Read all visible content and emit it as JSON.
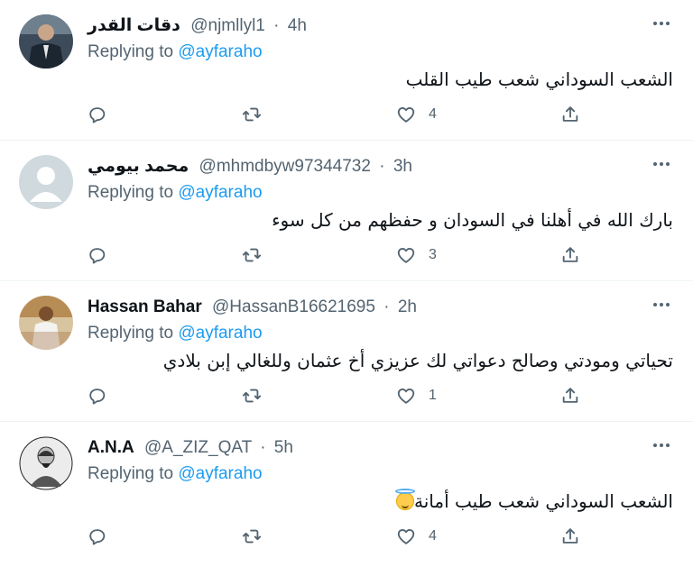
{
  "tweets": [
    {
      "name": "دقات القدر",
      "handle": "@njmllyl1",
      "dot": "·",
      "time": "4h",
      "replying_prefix": "Replying to ",
      "replying_to": "@ayfaraho",
      "text": "الشعب السوداني شعب طيب القلب",
      "has_emoji": false,
      "likes": "4",
      "avatar": "suit-photo"
    },
    {
      "name": "محمد بيومي",
      "handle": "@mhmdbyw97344732",
      "dot": "·",
      "time": "3h",
      "replying_prefix": "Replying to ",
      "replying_to": "@ayfaraho",
      "text": "بارك الله في أهلنا في السودان و حفظهم من كل سوء",
      "has_emoji": false,
      "likes": "3",
      "avatar": "default-avatar"
    },
    {
      "name": "Hassan Bahar",
      "handle": "@HassanB16621695",
      "dot": "·",
      "time": "2h",
      "replying_prefix": "Replying to ",
      "replying_to": "@ayfaraho",
      "text": "تحياتي ومودتي وصالح دعواتي لك عزيزي أخ عثمان وللغالي إبن بلادي",
      "has_emoji": false,
      "likes": "1",
      "avatar": "white-robe-photo"
    },
    {
      "name": "A.N.A",
      "handle": "@A_ZIZ_QAT",
      "dot": "·",
      "time": "5h",
      "replying_prefix": "Replying to ",
      "replying_to": "@ayfaraho",
      "text": "الشعب السوداني شعب طيب أمانة",
      "has_emoji": true,
      "likes": "4",
      "avatar": "bw-sketch-photo"
    }
  ],
  "colors": {
    "accent": "#1d9bf0",
    "muted": "#536471",
    "text": "#0f1419",
    "divider": "#eff3f4"
  },
  "icons": [
    "reply-icon",
    "retweet-icon",
    "like-icon",
    "share-icon",
    "more-icon",
    "smiling-face-with-halo-emoji"
  ]
}
